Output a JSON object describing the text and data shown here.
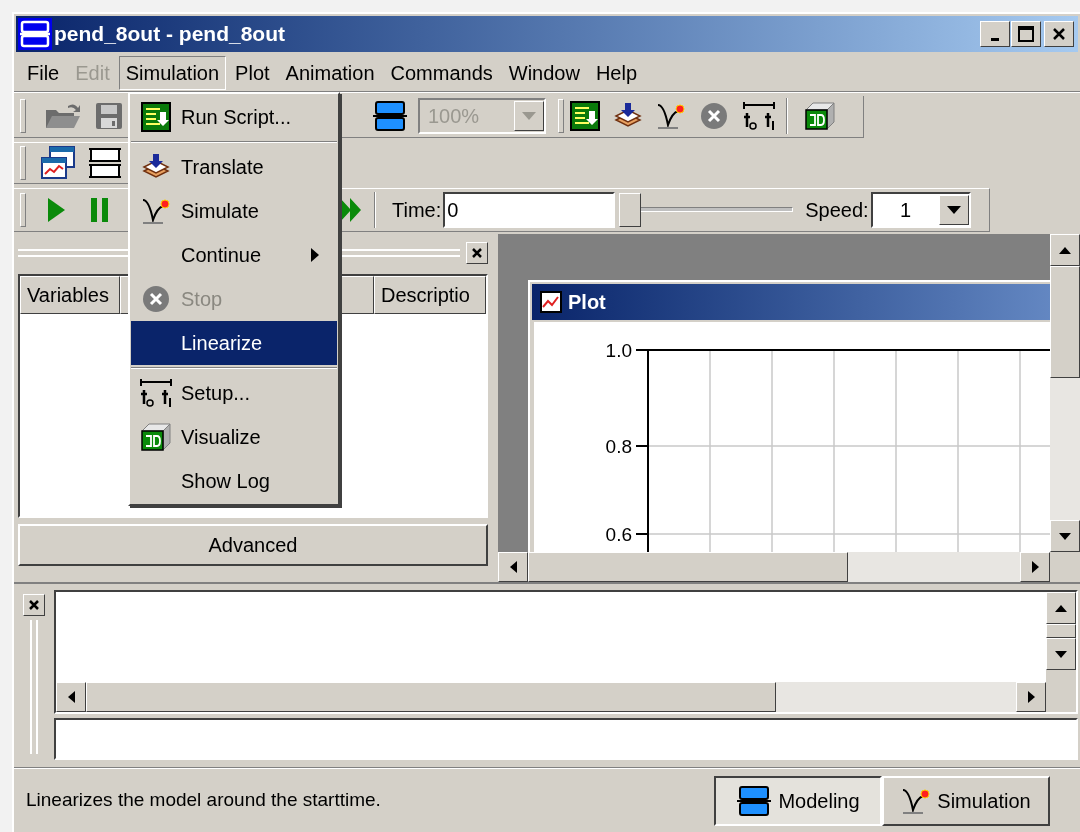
{
  "window": {
    "title": "pend_8out - pend_8out"
  },
  "menu_bar": [
    {
      "label": "File",
      "disabled": false,
      "selected": false
    },
    {
      "label": "Edit",
      "disabled": true,
      "selected": false
    },
    {
      "label": "Simulation",
      "disabled": false,
      "selected": true
    },
    {
      "label": "Plot",
      "disabled": false,
      "selected": false
    },
    {
      "label": "Animation",
      "disabled": false,
      "selected": false
    },
    {
      "label": "Commands",
      "disabled": false,
      "selected": false
    },
    {
      "label": "Window",
      "disabled": false,
      "selected": false
    },
    {
      "label": "Help",
      "disabled": false,
      "selected": false
    }
  ],
  "simulation_menu": [
    {
      "kind": "item",
      "label": "Run Script...",
      "disabled": false,
      "selected": false,
      "submenu": false
    },
    {
      "kind": "separator"
    },
    {
      "kind": "item",
      "label": "Translate",
      "disabled": false,
      "selected": false,
      "submenu": false
    },
    {
      "kind": "item",
      "label": "Simulate",
      "disabled": false,
      "selected": false,
      "submenu": false
    },
    {
      "kind": "item",
      "label": "Continue",
      "disabled": false,
      "selected": false,
      "submenu": true
    },
    {
      "kind": "item",
      "label": "Stop",
      "disabled": true,
      "selected": false,
      "submenu": false
    },
    {
      "kind": "item",
      "label": "Linearize",
      "disabled": false,
      "selected": true,
      "submenu": false
    },
    {
      "kind": "separator"
    },
    {
      "kind": "item",
      "label": "Setup...",
      "disabled": false,
      "selected": false,
      "submenu": false
    },
    {
      "kind": "item",
      "label": "Visualize",
      "disabled": false,
      "selected": false,
      "submenu": false
    },
    {
      "kind": "item",
      "label": "Show Log",
      "disabled": false,
      "selected": false,
      "submenu": false
    }
  ],
  "toolbar": {
    "zoom": {
      "value": "100%",
      "disabled": true
    },
    "time_label": "Time:",
    "time_value": "0",
    "time_slider": {
      "level": 0
    },
    "speed_label": "Speed:",
    "speed_value": "1"
  },
  "variables_panel": {
    "columns": [
      "Variables",
      "Descriptio"
    ],
    "button": "Advanced"
  },
  "plot_window": {
    "title": "Plot",
    "y_ticks": [
      "1.0",
      "0.8",
      "0.6"
    ]
  },
  "status_bar": {
    "message": "Linearizes the model around the starttime.",
    "modes": [
      {
        "label": "Modeling",
        "selected": true
      },
      {
        "label": "Simulation",
        "selected": false
      }
    ]
  }
}
